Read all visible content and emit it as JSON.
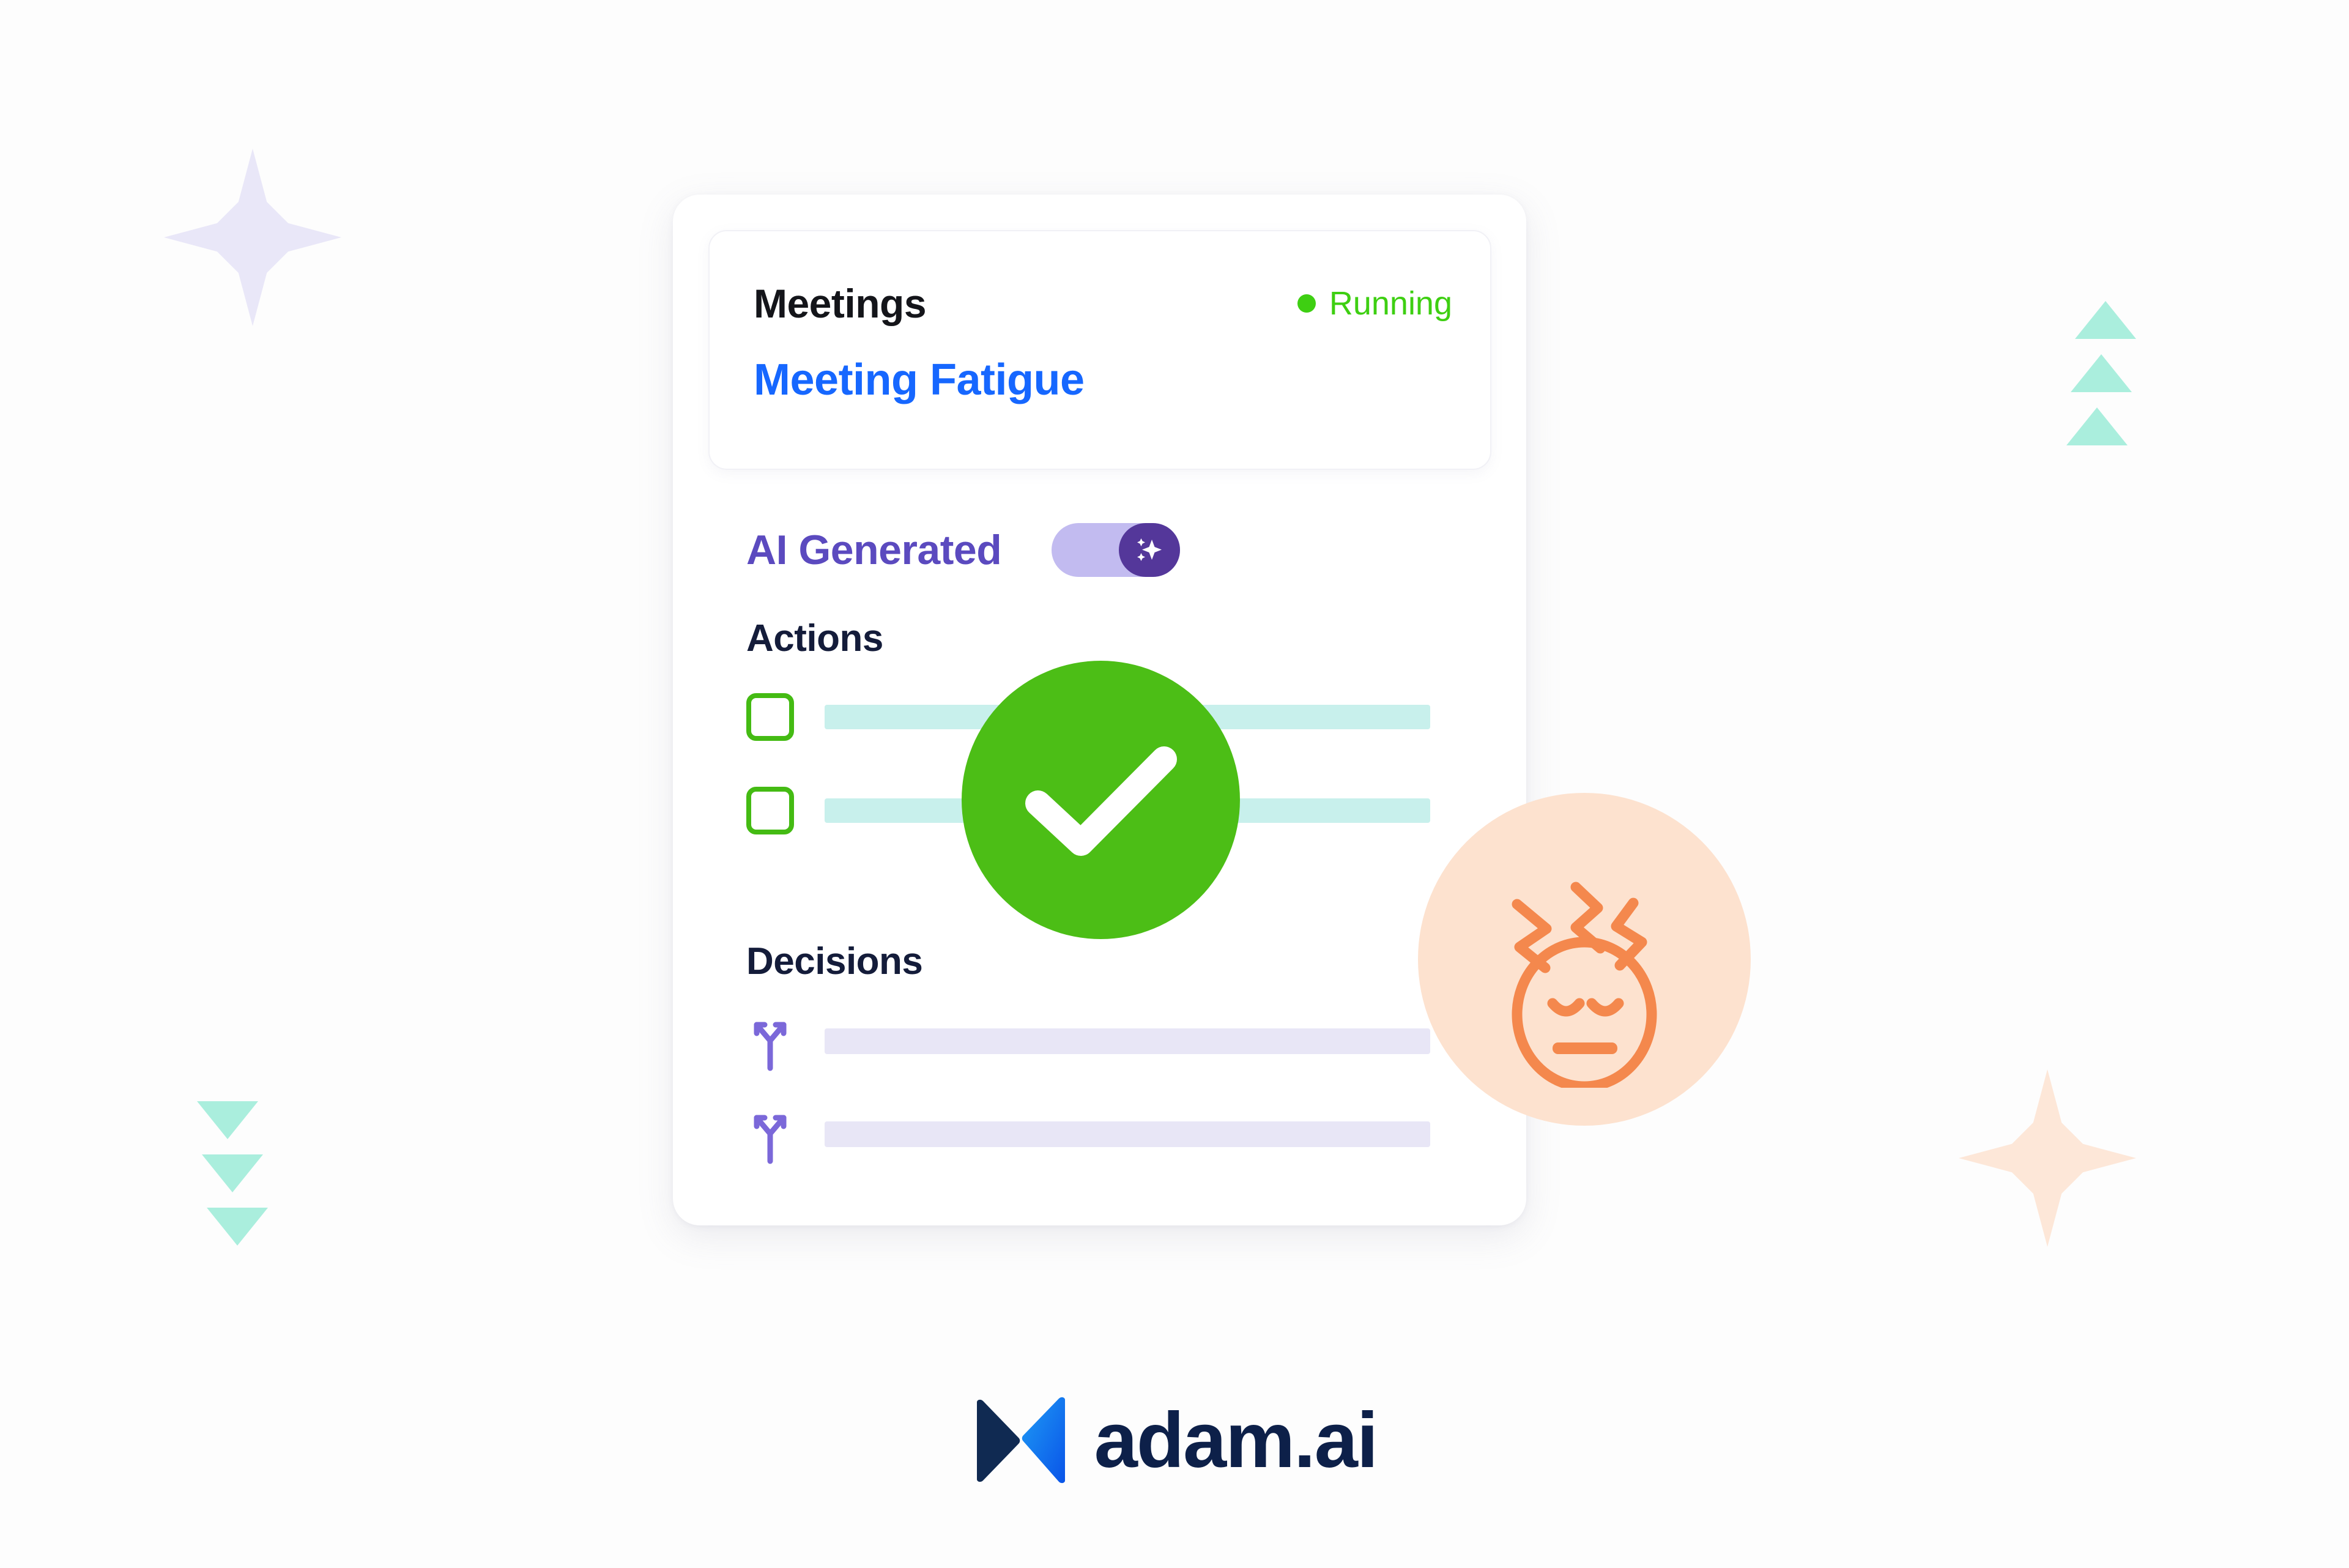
{
  "brand": {
    "name": "adam.ai",
    "logo_icon": "adam-butterfly-logo-icon",
    "logo_dark_color": "#0d2049",
    "logo_blue_color": "#1b7ef5"
  },
  "card": {
    "header": {
      "title": "Meetings",
      "status": {
        "label": "Running",
        "dot_icon": "status-dot-icon",
        "color": "#3ecf12"
      },
      "subtitle": "Meeting Fatigue",
      "subtitle_color": "#1667ff"
    },
    "ai_generated": {
      "label": "AI Generated",
      "label_color": "#5b4abf",
      "toggle_state": "on",
      "toggle_icon": "ai-sparkle-icon",
      "track_color": "#c2bbf0",
      "knob_color": "#54379a"
    },
    "actions": {
      "heading": "Actions",
      "items": [
        {
          "checked": false,
          "checkbox_icon": "checkbox-unchecked-icon"
        },
        {
          "checked": false,
          "checkbox_icon": "checkbox-unchecked-icon"
        }
      ],
      "bar_color": "#c8f0ec",
      "checkbox_color": "#44bb13"
    },
    "decisions": {
      "heading": "Decisions",
      "items": [
        {
          "icon": "decision-fork-icon"
        },
        {
          "icon": "decision-fork-icon"
        }
      ],
      "bar_color": "#e8e6f6",
      "icon_color": "#7b68d9"
    },
    "overlays": {
      "success_check": {
        "icon": "check-circle-icon",
        "color": "#4cbe16"
      },
      "fatigue_badge": {
        "icon": "tired-face-icon",
        "background_color": "#fde2cf",
        "stroke_color": "#f4884d"
      }
    }
  },
  "decorations": {
    "lavender_star": {
      "icon": "four-point-star-icon",
      "color": "#e9e7f8"
    },
    "peach_star": {
      "icon": "four-point-star-icon",
      "color": "#fde7d8"
    },
    "mint_triangles_up": {
      "icon": "triangle-up-icon",
      "color": "#aaeedd",
      "count": 3
    },
    "mint_triangles_down": {
      "icon": "triangle-down-icon",
      "color": "#aaeedd",
      "count": 3
    }
  }
}
